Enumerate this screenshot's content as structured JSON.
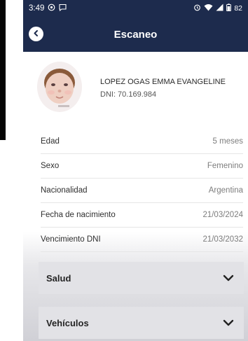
{
  "status_bar": {
    "time": "3:49",
    "battery": "82",
    "left_icons": [
      "location-icon",
      "message-icon"
    ],
    "right_icons": [
      "alarm-icon",
      "wifi-icon",
      "signal-icon",
      "battery-icon"
    ]
  },
  "app_bar": {
    "title": "Escaneo",
    "back_icon": "back-icon"
  },
  "profile": {
    "name": "LOPEZ OGAS EMMA EVANGELINE",
    "dni": "DNI: 70.169.984"
  },
  "details": [
    {
      "label": "Edad",
      "value": "5 meses"
    },
    {
      "label": "Sexo",
      "value": "Femenino"
    },
    {
      "label": "Nacionalidad",
      "value": "Argentina"
    },
    {
      "label": "Fecha de nacimiento",
      "value": "21/03/2024"
    },
    {
      "label": "Vencimiento DNI",
      "value": "21/03/2032"
    }
  ],
  "sections": [
    {
      "label": "Salud",
      "icon": "chevron-down-icon"
    },
    {
      "label": "Vehículos",
      "icon": "chevron-down-icon"
    }
  ],
  "colors": {
    "header": "#1d2b4d",
    "section_bg": "#e2e2e6",
    "value_text": "#7d7d7d"
  }
}
